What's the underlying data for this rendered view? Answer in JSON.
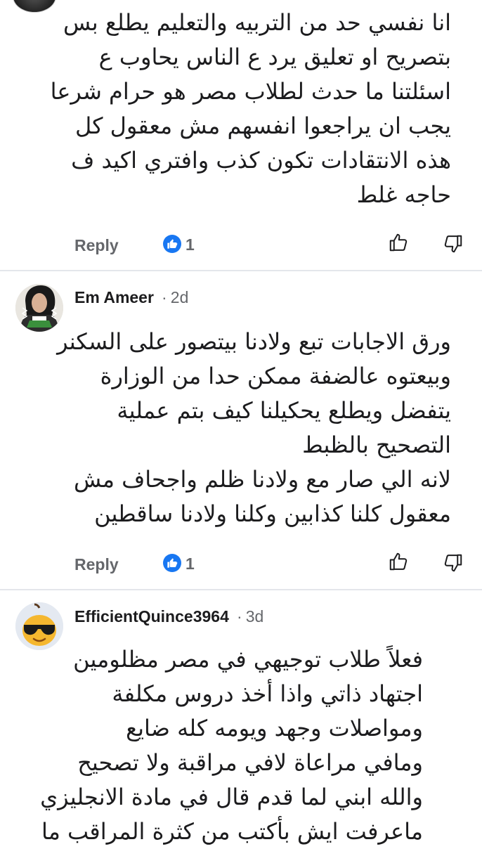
{
  "colors": {
    "accent": "#1877f2",
    "muted": "#65676b",
    "divider": "#e4e6eb"
  },
  "comments": [
    {
      "author": "",
      "lines": [
        "انا نفسي حد من التربيه والتعليم يطلع بس",
        "بتصريح او تعليق يرد ع الناس يحاوب ع",
        "اسئلتنا ما حدث لطلاب مصر هو حرام شرعا",
        "يجب ان يراجعوا انفسهم مش معقول كل",
        "هذه الانتقادات تكون كذب وافتري اكيد ف",
        "حاجه غلط"
      ],
      "reply_label": "Reply",
      "like_count": "1",
      "avatar_icon": "user-avatar-icon"
    },
    {
      "author": "Em Ameer",
      "time": "2d",
      "separator": "·",
      "lines": [
        "ورق الاجابات تبع ولادنا بيتصور على السكنر",
        "وبيعتوه عالضفة ممكن حدا من الوزارة",
        "يتفضل ويطلع يحكيلنا كيف بتم عملية",
        "التصحيح بالظبط",
        "لانه الي صار مع ولادنا ظلم واجحاف مش",
        "معقول كلنا كذابين وكلنا ولادنا ساقطين"
      ],
      "reply_label": "Reply",
      "like_count": "1",
      "avatar_icon": "woman-keffiyeh-avatar-icon"
    },
    {
      "author": "EfficientQuince3964",
      "time": "3d",
      "separator": "·",
      "lines": [
        "فعلاً طلاب توجيهي في مصر مظلومين",
        "اجتهاد ذاتي واذا أخذ دروس مكلفة",
        "ومواصلات وجهد ويومه كله ضايع",
        "ومافي مراعاة لافي مراقبة ولا تصحيح",
        "والله ابني لما قدم قال في مادة الانجليزي",
        "ماعرفت ايش بأكتب من كثرة المراقب ما"
      ],
      "avatar_icon": "sunglasses-emoji-avatar-icon"
    }
  ]
}
